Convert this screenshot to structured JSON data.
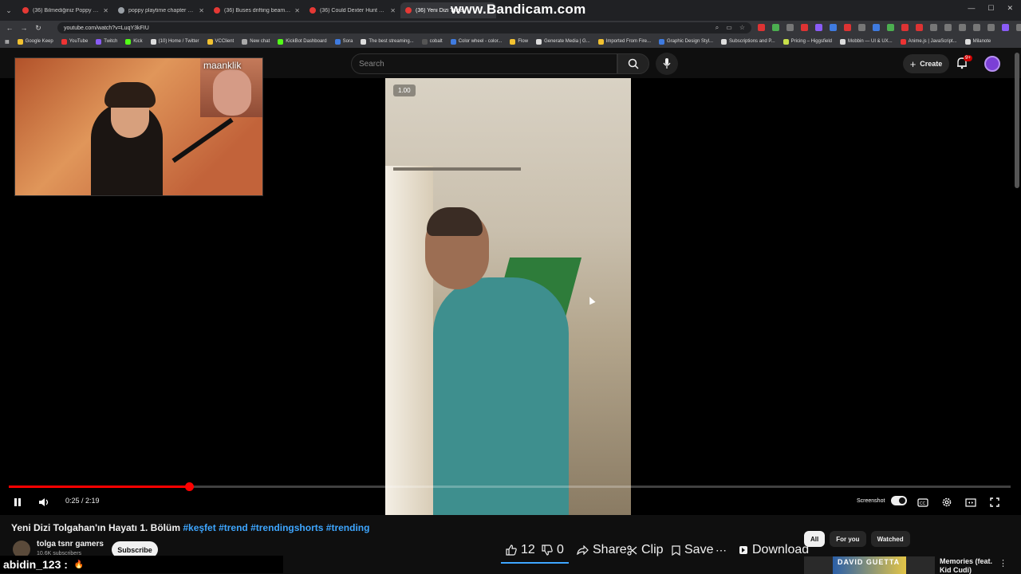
{
  "browser": {
    "tabs": [
      {
        "label": "(36) Bilmediğiniz Poppy Playtim",
        "icon": "youtube-icon"
      },
      {
        "label": "poppy playtime chapter 5 relea",
        "icon": "globe-icon"
      },
      {
        "label": "(36) Buses drifting beaming dr",
        "icon": "youtube-icon"
      },
      {
        "label": "(36) Could Dexter Hunt Down t",
        "icon": "youtube-icon"
      },
      {
        "label": "(36) Yeni Dizi Tolga",
        "icon": "youtube-icon",
        "active": true
      }
    ],
    "watermark": "www.Bandicam.com",
    "url": "youtube.com/watch?v=LuqY3kFIU",
    "bookmarks": [
      "Google Keep",
      "YouTube",
      "Twitch",
      "Kick",
      "(10) Home / Twitter",
      "VCClient",
      "New chat",
      "KickBot Dashboard",
      "Sora",
      "The best streaming...",
      "cobalt",
      "Color wheel - color...",
      "Flow",
      "Generate Media | G...",
      "Imported From Fire...",
      "Graphic Design Styl...",
      "Subscriptions and P...",
      "Pricing – Higgsfield",
      "Mobbin — UI & UX...",
      "Anime.js | JavaScript...",
      "Milanote"
    ]
  },
  "header": {
    "search_placeholder": "Search",
    "create_label": "Create",
    "notification_count": "9+"
  },
  "player": {
    "speed_badge": "1.00",
    "webcam_inset_name": "maanklik",
    "time_display": "0:25 / 2:19",
    "progress": 0.18,
    "screenshot_label": "Screenshot"
  },
  "video": {
    "title_main": "Yeni Dizi Tolgahan'ın Hayatı 1. Bölüm",
    "hashtags": [
      "#keşfet",
      "#trend",
      "#trendingshorts",
      "#trending"
    ],
    "channel_name": "tolga tsnr gamers",
    "subscribers": "10.6K subscribers",
    "subscribe_label": "Subscribe",
    "likes": "12",
    "dislikes": "0",
    "share_label": "Share",
    "clip_label": "Clip",
    "save_label": "Save",
    "download_label": "Download"
  },
  "chat": {
    "username": "abidin_123 :",
    "message": "🔥"
  },
  "recommendations": {
    "chips": [
      {
        "label": "All",
        "active": true
      },
      {
        "label": "For you",
        "active": false
      },
      {
        "label": "Watched",
        "active": false
      }
    ],
    "first_title": "Memories (feat. Kid Cudi)",
    "first_thumb_text": "DAVID GUETTA"
  }
}
